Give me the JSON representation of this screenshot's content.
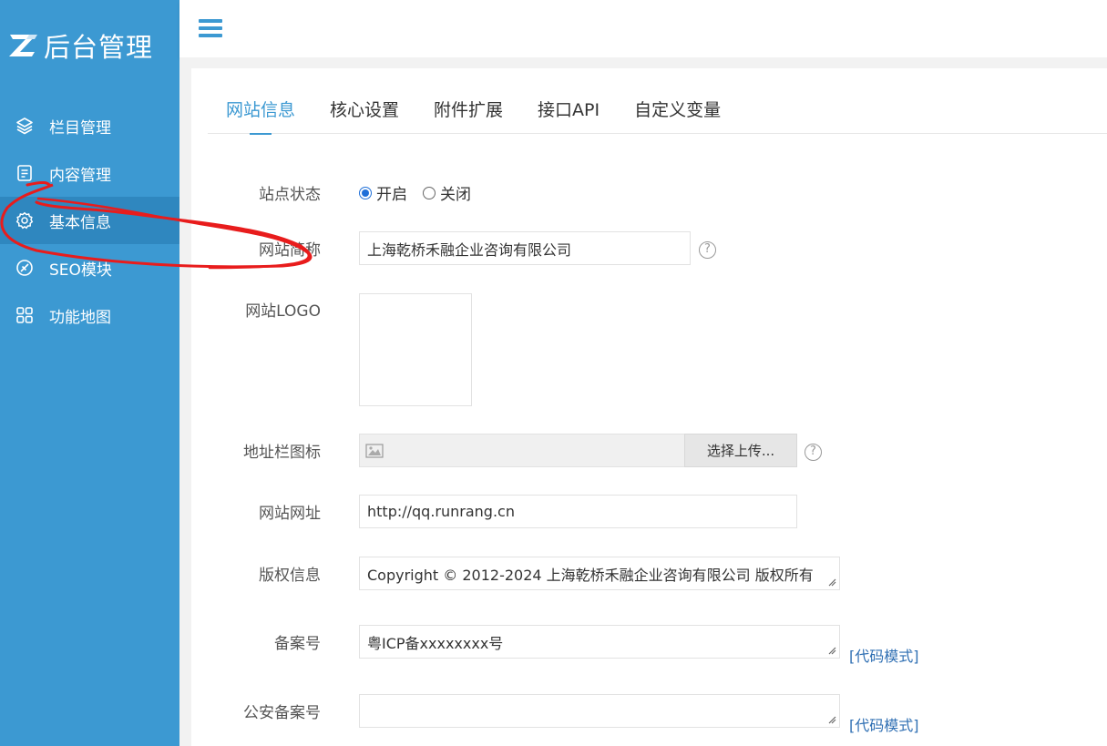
{
  "app": {
    "title": "后台管理",
    "brand_color": "#3c99d2"
  },
  "sidebar": {
    "items": [
      {
        "label": "栏目管理",
        "icon": "layers-icon"
      },
      {
        "label": "内容管理",
        "icon": "document-icon"
      },
      {
        "label": "基本信息",
        "icon": "gear-icon",
        "active": true
      },
      {
        "label": "SEO模块",
        "icon": "seo-icon"
      },
      {
        "label": "功能地图",
        "icon": "grid-icon"
      }
    ]
  },
  "header": {
    "menu_icon": "hamburger-icon"
  },
  "tabs": [
    "网站信息",
    "核心设置",
    "附件扩展",
    "接口API",
    "自定义变量"
  ],
  "form": {
    "site_status": {
      "label": "站点状态",
      "options": [
        "开启",
        "关闭"
      ],
      "selected": "开启"
    },
    "site_name": {
      "label": "网站简称",
      "value": "上海乾桥禾融企业咨询有限公司"
    },
    "site_logo": {
      "label": "网站LOGO"
    },
    "favicon": {
      "label": "地址栏图标",
      "button": "选择上传..."
    },
    "site_url": {
      "label": "网站网址",
      "value": "http://qq.runrang.cn"
    },
    "copyright": {
      "label": "版权信息",
      "value": "Copyright © 2012-2024 上海乾桥禾融企业咨询有限公司 版权所有"
    },
    "icp": {
      "label": "备案号",
      "value": "粤ICP备xxxxxxxx号",
      "link": "[代码模式]"
    },
    "police_icp": {
      "label": "公安备案号",
      "value": "",
      "link": "[代码模式]"
    }
  },
  "help_glyph": "?"
}
